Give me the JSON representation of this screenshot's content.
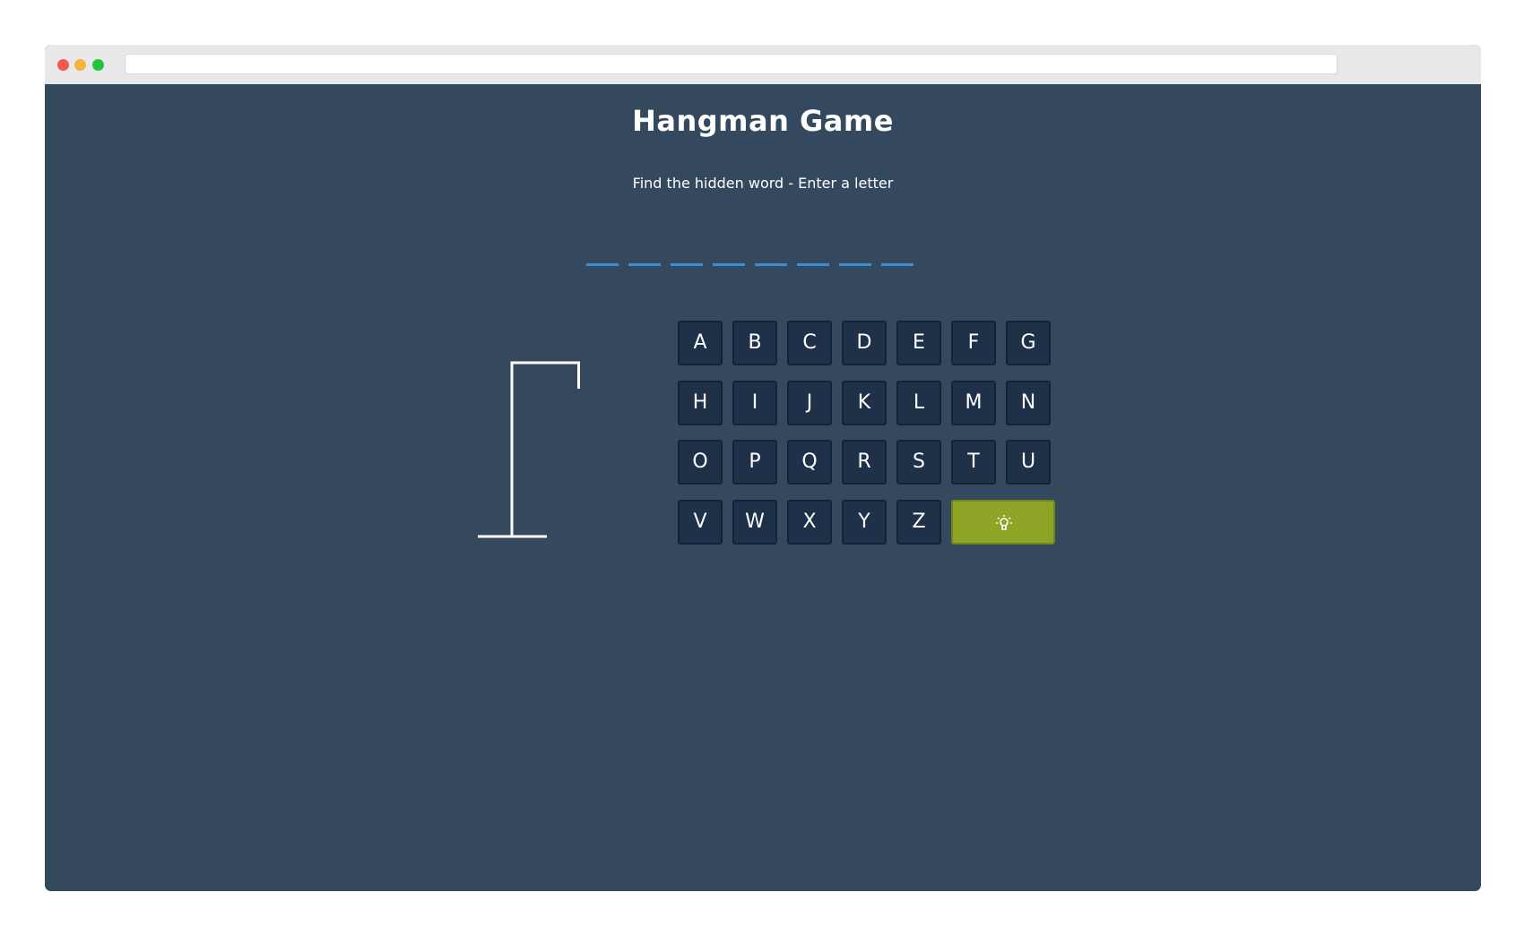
{
  "game": {
    "title": "Hangman Game",
    "instruction": "Find the hidden word - Enter a letter",
    "word_slots": [
      "",
      "",
      "",
      "",
      "",
      "",
      "",
      ""
    ]
  },
  "keyboard": {
    "rows": [
      [
        "A",
        "B",
        "C",
        "D",
        "E",
        "F",
        "G"
      ],
      [
        "H",
        "I",
        "J",
        "K",
        "L",
        "M",
        "N"
      ],
      [
        "O",
        "P",
        "Q",
        "R",
        "S",
        "T",
        "U"
      ],
      [
        "V",
        "W",
        "X",
        "Y",
        "Z"
      ]
    ],
    "hint_icon": "lightbulb-icon"
  },
  "colors": {
    "background": "#35495e",
    "key": "#1f3049",
    "hint": "#8da427",
    "slot_underline": "#3a8fd6"
  }
}
